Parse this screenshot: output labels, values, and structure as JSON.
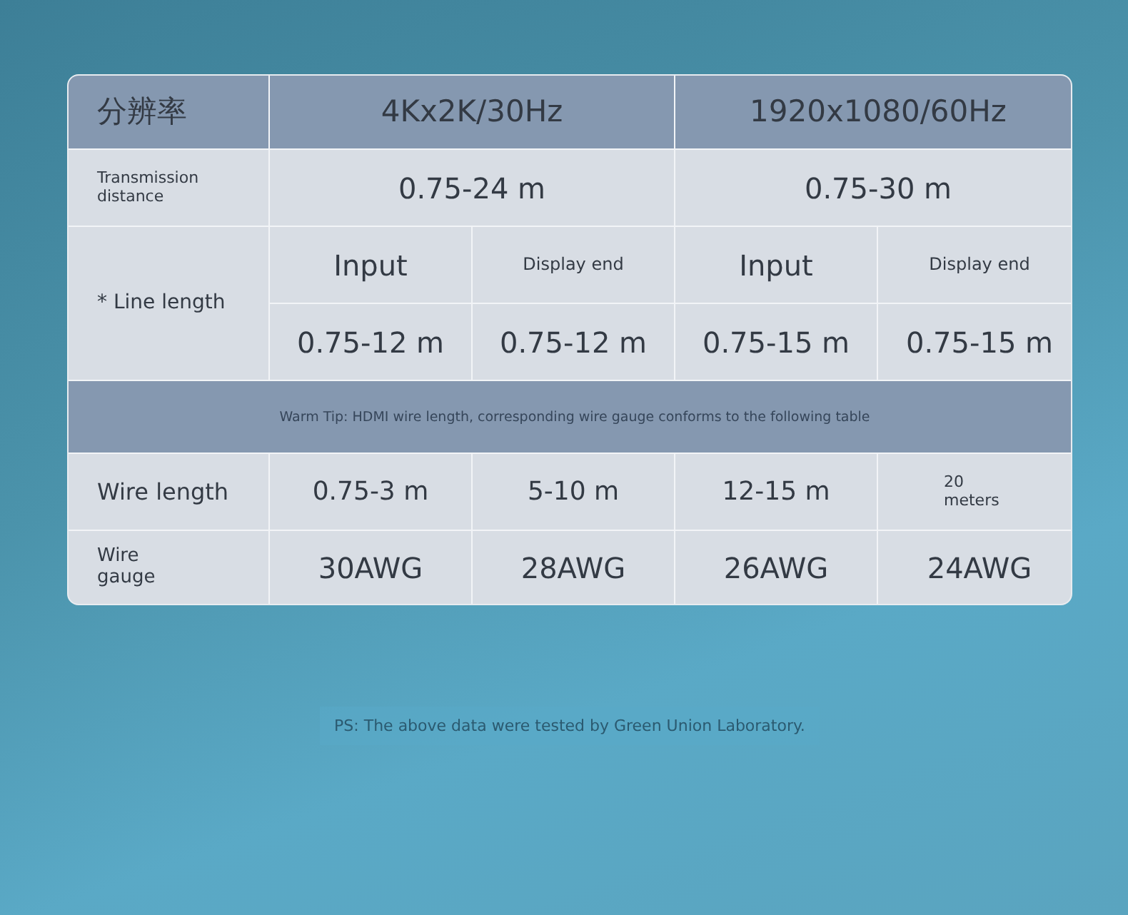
{
  "header": {
    "label": "分辨率",
    "columns": [
      "4Kx2K/30Hz",
      "1920x1080/60Hz"
    ]
  },
  "transmission": {
    "label": "Transmission distance",
    "values": [
      "0.75-24 m",
      "0.75-30 m"
    ]
  },
  "line_length": {
    "label": "* Line length",
    "subheaders": [
      "Input",
      "Display end",
      "Input",
      "Display end"
    ],
    "values": [
      "0.75-12 m",
      "0.75-12 m",
      "0.75-15 m",
      "0.75-15 m"
    ]
  },
  "tip": "Warm Tip: HDMI wire length, corresponding wire gauge conforms to the following table",
  "wire_length": {
    "label": "Wire length",
    "values": [
      "0.75-3 m",
      "5-10 m",
      "12-15 m",
      "20 meters"
    ]
  },
  "wire_gauge": {
    "label": "Wire gauge",
    "values": [
      "30AWG",
      "28AWG",
      "26AWG",
      "24AWG"
    ]
  },
  "footnote": "PS: The above data were tested by Green Union Laboratory."
}
